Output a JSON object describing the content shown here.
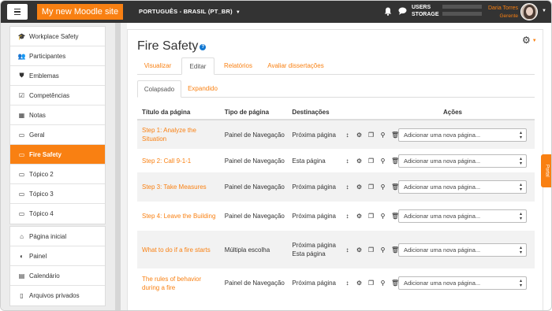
{
  "navbar": {
    "site_name": "My new Moodle site",
    "language": "PORTUGUÊS - BRASIL (PT_BR)",
    "users_label_line1": "USERS",
    "users_label_line2": "STORAGE",
    "user_name": "Daria Torres",
    "user_role": "Gerente"
  },
  "sidebar": {
    "groups": [
      {
        "items": [
          {
            "label": "Workplace Safety",
            "icon": "graduation-cap-icon",
            "glyph": "🎓"
          },
          {
            "label": "Participantes",
            "icon": "users-icon",
            "glyph": "👥"
          },
          {
            "label": "Emblemas",
            "icon": "shield-icon",
            "glyph": "⛊"
          },
          {
            "label": "Competências",
            "icon": "checkbox-icon",
            "glyph": "☑"
          },
          {
            "label": "Notas",
            "icon": "table-icon",
            "glyph": "▦"
          },
          {
            "label": "Geral",
            "icon": "folder-icon",
            "glyph": "▭"
          },
          {
            "label": "Fire Safety",
            "icon": "folder-icon",
            "glyph": "▭",
            "active": true
          },
          {
            "label": "Tópico 2",
            "icon": "folder-icon",
            "glyph": "▭"
          },
          {
            "label": "Tópico 3",
            "icon": "folder-icon",
            "glyph": "▭"
          },
          {
            "label": "Tópico 4",
            "icon": "folder-icon",
            "glyph": "▭"
          }
        ]
      },
      {
        "items": [
          {
            "label": "Página inicial",
            "icon": "home-icon",
            "glyph": "⌂"
          },
          {
            "label": "Painel",
            "icon": "dashboard-icon",
            "glyph": "◐"
          },
          {
            "label": "Calendário",
            "icon": "calendar-icon",
            "glyph": "▤"
          },
          {
            "label": "Arquivos privados",
            "icon": "file-icon",
            "glyph": "▯"
          }
        ]
      }
    ]
  },
  "page": {
    "title": "Fire Safety",
    "tabs": [
      "Visualizar",
      "Editar",
      "Relatórios",
      "Avaliar dissertações"
    ],
    "active_tab": 1,
    "subtabs": [
      "Colapsado",
      "Expandido"
    ],
    "active_subtab": 0,
    "portal_label": "Portal"
  },
  "table": {
    "headers": [
      "Título da página",
      "Tipo de página",
      "Destinações",
      "Ações"
    ],
    "rows": [
      {
        "title": "Step 1: Analyze the Situation",
        "type": "Painel de Navegação",
        "dest": "Próxima página",
        "select": "Adicionar uma nova página..."
      },
      {
        "title": "Step 2: Call 9-1-1",
        "type": "Painel de Navegação",
        "dest": "Esta página",
        "select": "Adicionar uma nova página..."
      },
      {
        "title": "Step 3: Take Measures",
        "type": "Painel de Navegação",
        "dest": "Próxima página",
        "select": "Adicionar uma nova página..."
      },
      {
        "title": "Step 4: Leave the Building",
        "type": "Painel de Navegação",
        "dest": "Próxima página",
        "select": "Adicionar uma nova página..."
      },
      {
        "title": "What to do if a fire starts",
        "type": "Múltipla escolha",
        "dest": "Próxima página Esta página",
        "select": "Adicionar uma nova página..."
      },
      {
        "title": "The rules of behavior during a fire",
        "type": "Painel de Navegação",
        "dest": "Próxima página",
        "select": "Adicionar uma nova página..."
      }
    ]
  },
  "colors": {
    "accent": "#f98012",
    "navbar": "#333333",
    "help": "#1177d1"
  }
}
